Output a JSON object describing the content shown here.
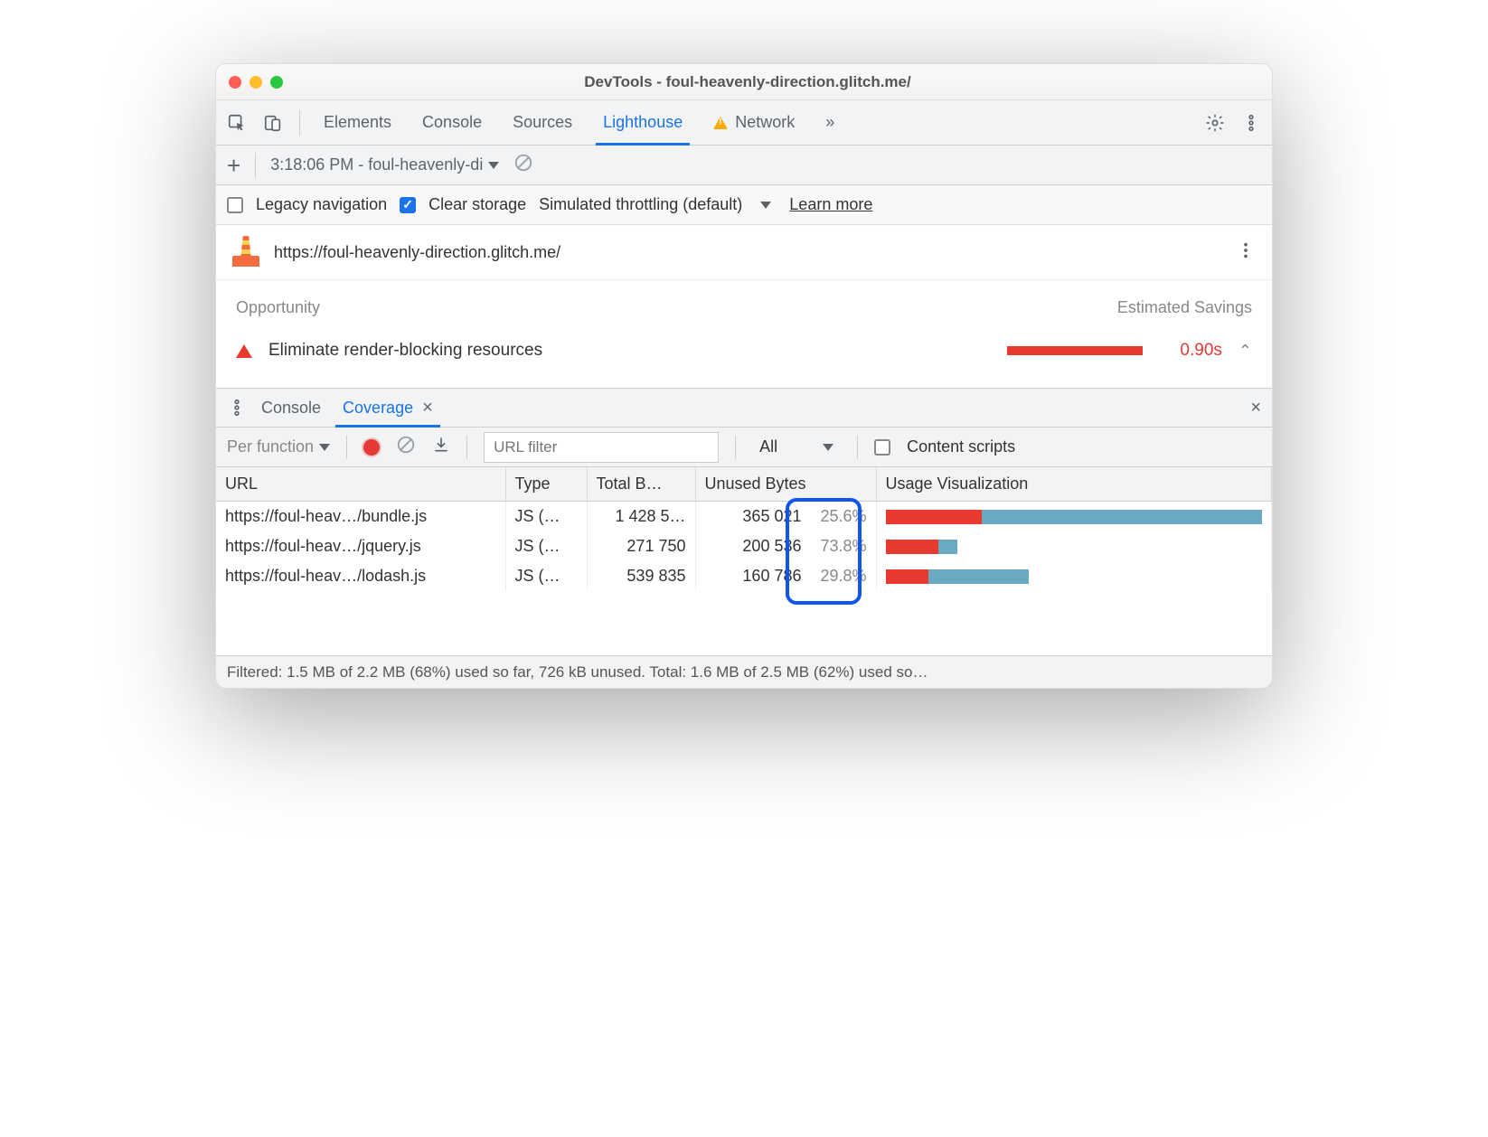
{
  "window": {
    "title": "DevTools - foul-heavenly-direction.glitch.me/"
  },
  "mainTabs": {
    "elements": "Elements",
    "console": "Console",
    "sources": "Sources",
    "lighthouse": "Lighthouse",
    "network": "Network",
    "more": "»"
  },
  "runBar": {
    "history": "3:18:06 PM - foul-heavenly-di"
  },
  "options": {
    "legacy": "Legacy navigation",
    "clearStorage": "Clear storage",
    "throttling": "Simulated throttling (default)",
    "learn": "Learn more"
  },
  "report": {
    "url": "https://foul-heavenly-direction.glitch.me/",
    "opportunityHeader": "Opportunity",
    "savingsHeader": "Estimated Savings",
    "item": {
      "label": "Eliminate render-blocking resources",
      "time": "0.90s"
    }
  },
  "drawer": {
    "console": "Console",
    "coverage": "Coverage"
  },
  "covBar": {
    "perFunction": "Per function",
    "filterPlaceholder": "URL filter",
    "typeSelect": "All",
    "contentScripts": "Content scripts"
  },
  "table": {
    "headers": {
      "url": "URL",
      "type": "Type",
      "total": "Total B…",
      "unused": "Unused Bytes",
      "viz": "Usage Visualization"
    },
    "rows": [
      {
        "url": "https://foul-heav…/bundle.js",
        "type": "JS (…",
        "total": "1 428 5…",
        "unused": "365 021",
        "pct": "25.6%",
        "unusedFrac": 0.256,
        "totalFrac": 1.0
      },
      {
        "url": "https://foul-heav…/jquery.js",
        "type": "JS (…",
        "total": "271 750",
        "unused": "200 536",
        "pct": "73.8%",
        "unusedFrac": 0.738,
        "totalFrac": 0.19
      },
      {
        "url": "https://foul-heav…/lodash.js",
        "type": "JS (…",
        "total": "539 835",
        "unused": "160 786",
        "pct": "29.8%",
        "unusedFrac": 0.298,
        "totalFrac": 0.38
      }
    ]
  },
  "status": "Filtered: 1.5 MB of 2.2 MB (68%) used so far, 726 kB unused. Total: 1.6 MB of 2.5 MB (62%) used so…"
}
